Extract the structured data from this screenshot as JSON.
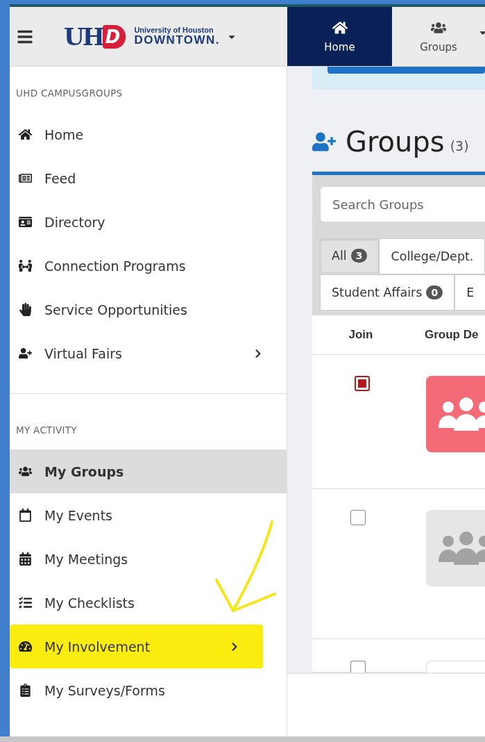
{
  "header": {
    "logo": {
      "mark": [
        "UH",
        "D"
      ],
      "line_1": "University of Houston",
      "line_2": "DOWNTOWN."
    },
    "nav": [
      {
        "label": "Home",
        "selected": true
      },
      {
        "label": "Groups",
        "selected": false
      }
    ]
  },
  "sidebar": {
    "sections": [
      {
        "title": "UHD CAMPUSGROUPS",
        "items": [
          {
            "label": "Home",
            "selected": false,
            "highlighted": false,
            "submenu": false
          },
          {
            "label": "Feed",
            "selected": false,
            "highlighted": false,
            "submenu": false
          },
          {
            "label": "Directory",
            "selected": false,
            "highlighted": false,
            "submenu": false
          },
          {
            "label": "Connection Programs",
            "selected": false,
            "highlighted": false,
            "submenu": false
          },
          {
            "label": "Service Opportunities",
            "selected": false,
            "highlighted": false,
            "submenu": false
          },
          {
            "label": "Virtual Fairs",
            "selected": false,
            "highlighted": false,
            "submenu": true
          }
        ]
      },
      {
        "title": "MY ACTIVITY",
        "items": [
          {
            "label": "My Groups",
            "selected": true,
            "highlighted": false,
            "submenu": false
          },
          {
            "label": "My Events",
            "selected": false,
            "highlighted": false,
            "submenu": false
          },
          {
            "label": "My Meetings",
            "selected": false,
            "highlighted": false,
            "submenu": false
          },
          {
            "label": "My Checklists",
            "selected": false,
            "highlighted": false,
            "submenu": false
          },
          {
            "label": "My Involvement",
            "selected": false,
            "highlighted": true,
            "submenu": true
          },
          {
            "label": "My Surveys/Forms",
            "selected": false,
            "highlighted": false,
            "submenu": false
          }
        ]
      }
    ]
  },
  "page": {
    "title": "Groups",
    "count": "(3)",
    "search": {
      "placeholder": "Search Groups"
    },
    "filters": [
      [
        {
          "label": "All",
          "badge": "3",
          "selected": true
        },
        {
          "label": "College/Dept.",
          "selected": false
        }
      ],
      [
        {
          "label": "Student Affairs",
          "badge": "0",
          "selected": false
        },
        {
          "label": "E",
          "selected": false
        }
      ]
    ],
    "columns": [
      "Join",
      "Group De"
    ],
    "rows": [
      {
        "checked": true,
        "kind": "colored"
      },
      {
        "checked": false,
        "kind": "placeholder"
      },
      {
        "checked": false,
        "kind": "empty"
      }
    ]
  }
}
